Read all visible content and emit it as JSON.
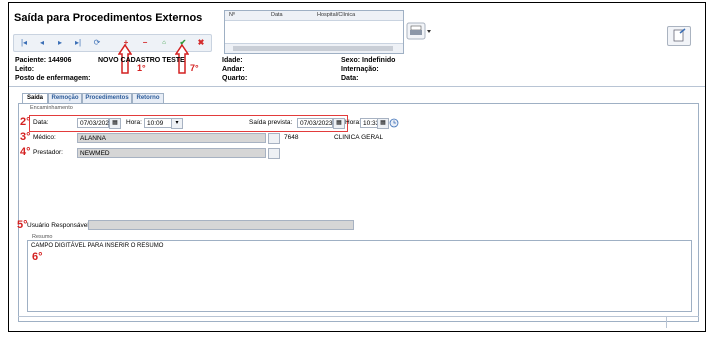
{
  "window": {
    "title": "Saída para Procedimentos Externos"
  },
  "toolbar": {
    "buttons": [
      {
        "name": "first-record-button",
        "glyph": "|◂"
      },
      {
        "name": "prev-record-button",
        "glyph": "◂"
      },
      {
        "name": "next-record-button",
        "glyph": "▸"
      },
      {
        "name": "last-record-button",
        "glyph": "▸|"
      },
      {
        "name": "refresh-button",
        "glyph": "⟳"
      },
      {
        "name": "add-button",
        "glyph": "+"
      },
      {
        "name": "remove-button",
        "glyph": "−"
      },
      {
        "name": "edit-button",
        "glyph": "⌂"
      },
      {
        "name": "confirm-button",
        "glyph": "✔"
      },
      {
        "name": "cancel-button",
        "glyph": "✖"
      }
    ]
  },
  "grid": {
    "columns": [
      "Nº",
      "Data",
      "Hospital/Clínica"
    ]
  },
  "patient": {
    "paciente_label": "Paciente:",
    "paciente_value": "144906",
    "nome_value": "NOVO CADASTRO TESTE",
    "leito_label": "Leito:",
    "posto_label": "Posto de enfermagem:",
    "idade_label": "Idade:",
    "andar_label": "Andar:",
    "quarto_label": "Quarto:",
    "sexo_label": "Sexo:",
    "sexo_value": "Indefinido",
    "internacao_label": "Internação:",
    "data_label": "Data:"
  },
  "tabs": [
    "Saída",
    "Remoção",
    "Procedimentos",
    "Retorno"
  ],
  "encaminhamento": {
    "legend": "Encaminhamento",
    "data_label": "Data:",
    "data_value": "07/03/2023",
    "hora_label": "Hora:",
    "hora_value": "10:09",
    "saida_prevista_label": "Saída prevista:",
    "saida_prevista_value": "07/03/2023",
    "hora2_label": "Hora:",
    "hora2_value": "10:33",
    "medico_label": "Médico:",
    "medico_value": "ALANNA",
    "medico_code": "7648",
    "medico_especialidade": "CLINICA GERAL",
    "prestador_label": "Prestador:",
    "prestador_value": "NEWMED",
    "usuario_label": "Usuário Responsável:",
    "usuario_value": ""
  },
  "resumo": {
    "legend": "Resumo",
    "text": "CAMPO DIGITÁVEL PARA INSERIR O RESUMO"
  },
  "annotations": {
    "m1": "1°",
    "m7": "7°",
    "m2": "2°",
    "m3": "3°",
    "m4": "4°",
    "m5": "5°",
    "m6": "6°"
  },
  "colors": {
    "annotation_red": "#d42020",
    "accent_blue": "#2d5c9a"
  }
}
